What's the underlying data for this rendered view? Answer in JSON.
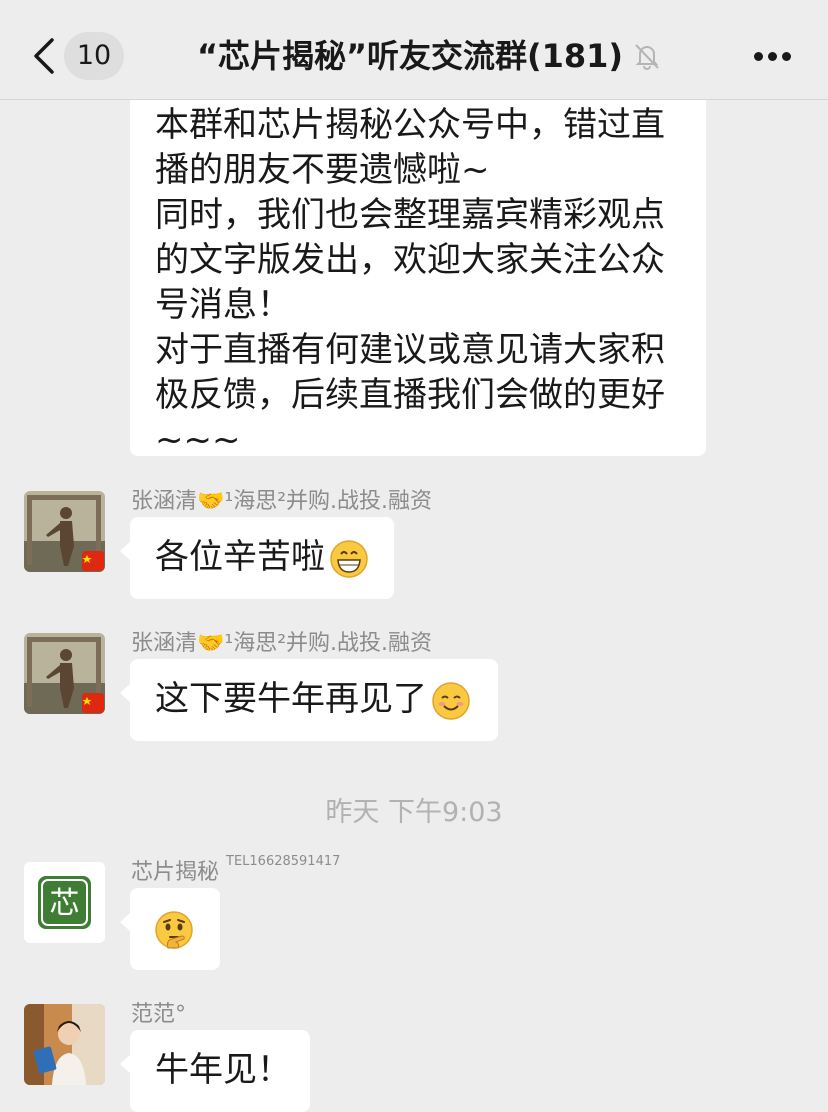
{
  "header": {
    "unread_count": "10",
    "title": "“芯片揭秘”听友交流群(181)",
    "icons": [
      "back-chevron-icon",
      "mute-bell-icon",
      "more-icon"
    ]
  },
  "messages": {
    "long": {
      "lines": [
        "本群和芯片揭秘公众号中，错过直",
        "播的朋友不要遗憾啦~",
        "同时，我们也会整理嘉宾精彩观点",
        "的文字版发出，欢迎大家关注公众",
        "号消息！",
        "对于直播有何建议或意见请大家积",
        "极反馈，后续直播我们会做的更好",
        "~~~"
      ]
    },
    "m1": {
      "sender": "张涵清🤝¹海思²并购.战投.融资",
      "text": "各位辛苦啦",
      "emoji": "grinning-face-icon"
    },
    "m2": {
      "sender": "张涵清🤝¹海思²并购.战投.融资",
      "text": "这下要牛年再见了",
      "emoji": "smiling-face-icon"
    },
    "timestamp": "昨天 下午9:03",
    "m3": {
      "sender": "芯片揭秘",
      "sender_tag": "TEL16628591417",
      "emoji": "thinking-face-icon",
      "avatar_char": "芯"
    },
    "m4": {
      "sender": "范范°",
      "text": "牛年见！"
    }
  },
  "colors": {
    "background": "#ededed",
    "bubble": "#ffffff",
    "name": "#8c8c8c",
    "brand_green": "#3f7d34"
  }
}
